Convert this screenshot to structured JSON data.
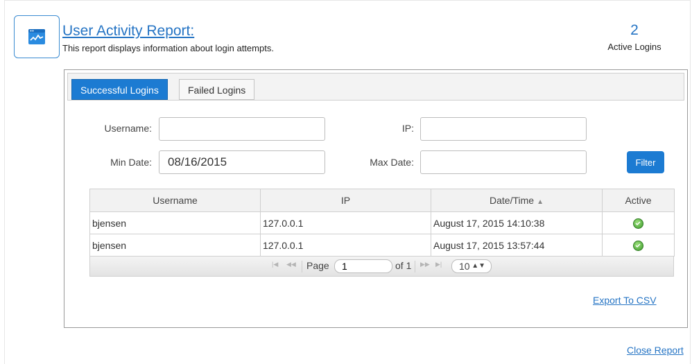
{
  "header": {
    "title": "User Activity Report:",
    "description": "This report displays information about login attempts.",
    "active_count": "2",
    "active_label": "Active Logins",
    "icon": "report-chart-icon"
  },
  "tabs": [
    {
      "label": "Successful Logins",
      "active": true
    },
    {
      "label": "Failed Logins",
      "active": false
    }
  ],
  "filters": {
    "username_label": "Username:",
    "username_value": "",
    "ip_label": "IP:",
    "ip_value": "",
    "min_date_label": "Min Date:",
    "min_date_value": "08/16/2015",
    "max_date_label": "Max Date:",
    "max_date_value": "",
    "filter_button": "Filter"
  },
  "table": {
    "columns": [
      "Username",
      "IP",
      "Date/Time",
      "Active"
    ],
    "rows": [
      {
        "username": "bjensen",
        "ip": "127.0.0.1",
        "datetime": "August 17, 2015 14:10:38",
        "active": true
      },
      {
        "username": "bjensen",
        "ip": "127.0.0.1",
        "datetime": "August 17, 2015 13:57:44",
        "active": true
      }
    ]
  },
  "pager": {
    "page_label": "Page",
    "page_value": "1",
    "of_label": "of 1",
    "page_size": "10"
  },
  "links": {
    "export": "Export To CSV",
    "close": "Close Report"
  },
  "colors": {
    "accent": "#1c7bd2",
    "link": "#2574c4",
    "active_check": "#3e9b2d"
  }
}
